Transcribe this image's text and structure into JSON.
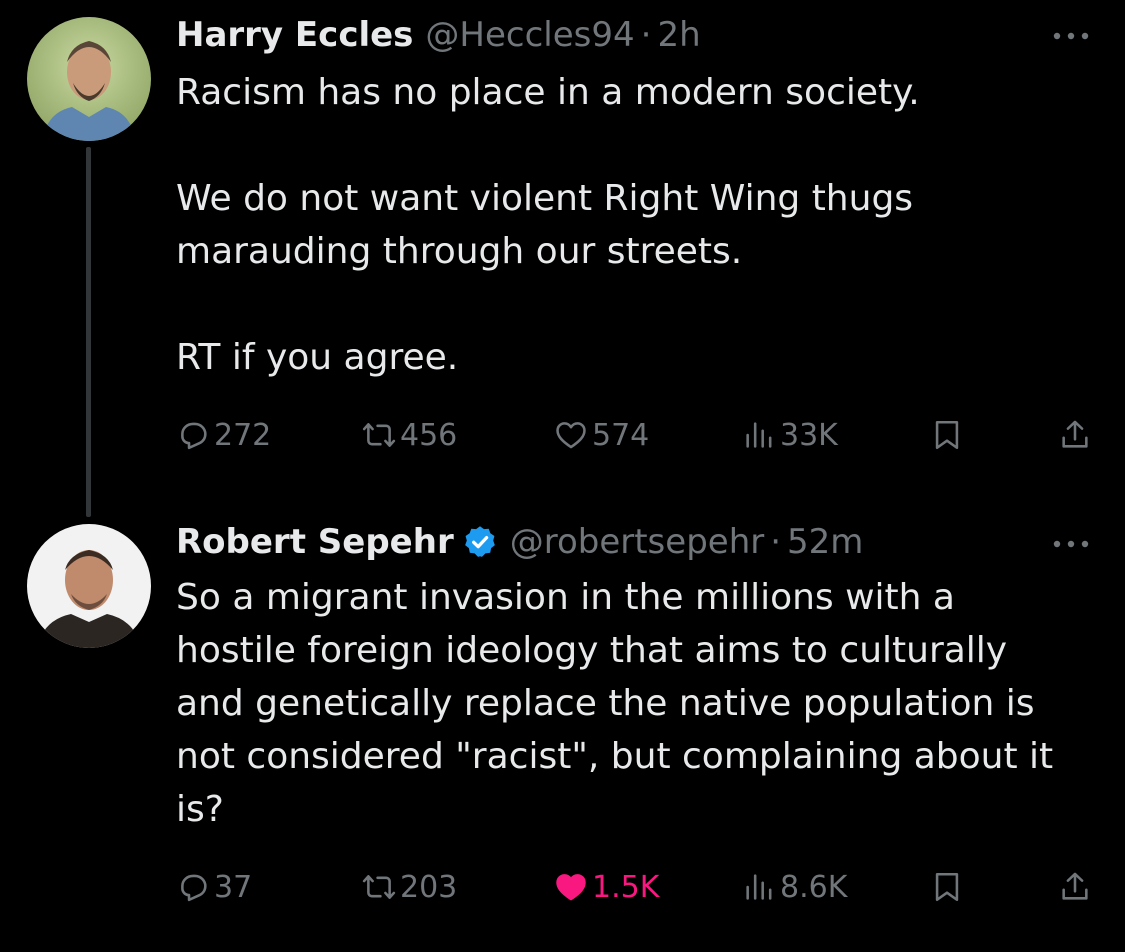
{
  "tweets": [
    {
      "display_name": "Harry Eccles",
      "handle": "@Heccles94",
      "separator": "·",
      "time": "2h",
      "verified": false,
      "paragraphs": [
        "Racism has no place in a modern society.",
        "We do not want violent Right Wing thugs marauding through our streets.",
        "RT if you agree."
      ],
      "stats": {
        "replies": "272",
        "retweets": "456",
        "likes": "574",
        "views": "33K"
      },
      "liked": false
    },
    {
      "display_name": "Robert Sepehr",
      "handle": "@robertsepehr",
      "separator": "·",
      "time": "52m",
      "verified": true,
      "paragraphs": [
        "So a migrant invasion in the millions with a hostile foreign ideology that aims to culturally and genetically replace the native population is not considered \"racist\", but complaining about it is?"
      ],
      "stats": {
        "replies": "37",
        "retweets": "203",
        "likes": "1.5K",
        "views": "8.6K"
      },
      "liked": true
    }
  ],
  "colors": {
    "background": "#000000",
    "text": "#e7e9ea",
    "secondary": "#71767b",
    "verified": "#1d9bf0",
    "like_active": "#f91880",
    "thread_line": "#333639"
  },
  "icons": {
    "reply": "reply-icon",
    "retweet": "retweet-icon",
    "like": "heart-icon",
    "views": "views-icon",
    "bookmark": "bookmark-icon",
    "share": "share-icon",
    "more": "more-icon",
    "verified": "verified-badge-icon"
  }
}
